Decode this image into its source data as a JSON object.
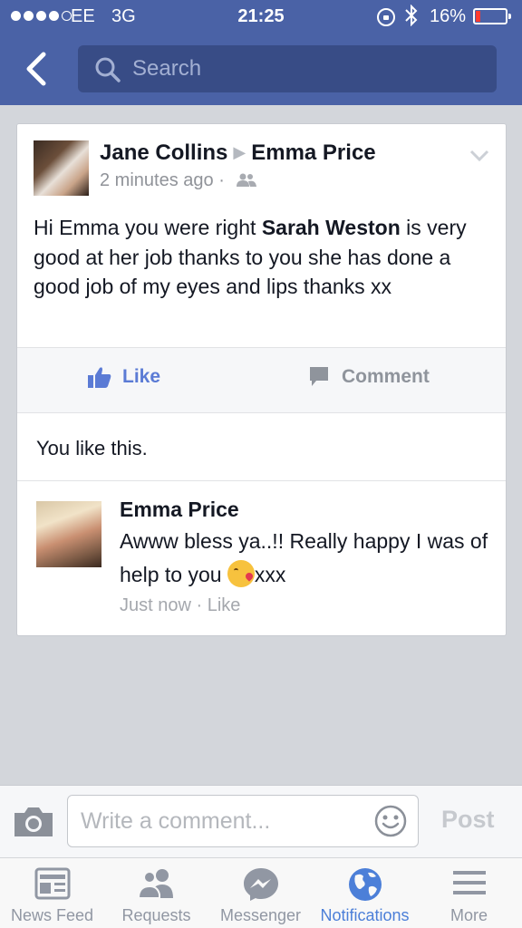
{
  "status_bar": {
    "carrier": "EE",
    "network": "3G",
    "time": "21:25",
    "battery_percent": "16%",
    "battery_level": 0.16,
    "signal_bars_filled": 4,
    "signal_bars_total": 5,
    "icons": [
      "orientation-lock-icon",
      "bluetooth-icon",
      "battery-icon"
    ]
  },
  "header": {
    "back_icon": "chevron-left-icon",
    "search_icon": "search-icon",
    "search_placeholder": "Search",
    "background_color": "#4a62a6"
  },
  "post": {
    "author": "Jane Collins",
    "recipient": "Emma Price",
    "timestamp": "2 minutes ago",
    "separator": "·",
    "audience_icon": "friends-icon",
    "menu_icon": "chevron-down-icon",
    "text_before": "Hi Emma you were right ",
    "text_bold": "Sarah Weston",
    "text_after": " is very good at her job thanks to you she has done a good job of my eyes and lips thanks xx",
    "actions": {
      "like_label": "Like",
      "comment_label": "Comment"
    },
    "likes_summary": "You like this."
  },
  "comment": {
    "author": "Emma Price",
    "text": "Awww bless ya..!! Really happy I was of help to you ",
    "emoji": "kissing-face-emoji",
    "text_after_emoji": "xxx",
    "timestamp": "Just now",
    "separator": "·",
    "like_label": "Like"
  },
  "composer": {
    "camera_icon": "camera-icon",
    "placeholder": "Write a comment...",
    "emoji_icon": "smiley-icon",
    "post_label": "Post"
  },
  "tab_bar": {
    "active_color": "#4c7fd8",
    "tabs": [
      {
        "label": "News Feed",
        "icon": "news-feed-icon",
        "active": false
      },
      {
        "label": "Requests",
        "icon": "friend-requests-icon",
        "active": false
      },
      {
        "label": "Messenger",
        "icon": "messenger-icon",
        "active": false
      },
      {
        "label": "Notifications",
        "icon": "globe-icon",
        "active": true
      },
      {
        "label": "More",
        "icon": "menu-icon",
        "active": false
      }
    ]
  }
}
